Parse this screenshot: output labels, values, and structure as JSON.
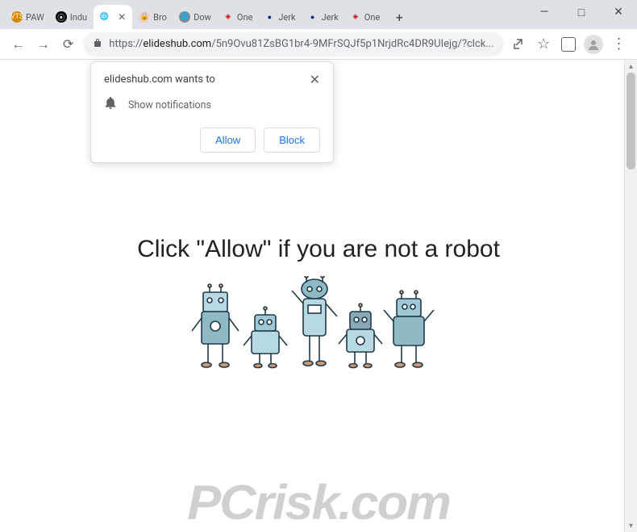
{
  "window": {
    "controls": {
      "min": "—",
      "max": "□",
      "close": "✕"
    }
  },
  "tabs": [
    {
      "label": "PAW",
      "favicon_bg": "#d98600",
      "favicon_txt": "VTS",
      "favicon_color": "#fff"
    },
    {
      "label": "Indu",
      "favicon_bg": "#000",
      "favicon_txt": "⦿",
      "favicon_color": "#fff"
    },
    {
      "label": "",
      "favicon_bg": "#fff",
      "favicon_txt": "🌐",
      "favicon_color": "#1a73e8",
      "active": true
    },
    {
      "label": "Bro",
      "favicon_bg": "#f5cccc",
      "favicon_txt": "🔒",
      "favicon_color": "#d08"
    },
    {
      "label": "Dow",
      "favicon_bg": "#888",
      "favicon_txt": "🌐",
      "favicon_color": "#fff"
    },
    {
      "label": "One",
      "favicon_bg": "#fff",
      "favicon_txt": "◈",
      "favicon_color": "#c00"
    },
    {
      "label": "Jerk",
      "favicon_bg": "#fff",
      "favicon_txt": "●",
      "favicon_color": "#0a2a66"
    },
    {
      "label": "Jerk",
      "favicon_bg": "#fff",
      "favicon_txt": "●",
      "favicon_color": "#0a2a66"
    },
    {
      "label": "One",
      "favicon_bg": "#fff",
      "favicon_txt": "◈",
      "favicon_color": "#c00"
    }
  ],
  "new_tab": "+",
  "nav": {
    "back": "←",
    "forward": "→",
    "reload": "⟳"
  },
  "url": {
    "protocol": "https://",
    "domain": "elideshub.com",
    "path": "/5n9Ovu81ZsBG1br4-9MFrSQJf5p1NrjdRc4DR9UIejg/?clck..."
  },
  "toolbar": {
    "share_icon": "↗",
    "star_icon": "☆",
    "menu_icon": "⋮"
  },
  "permission_popup": {
    "title": "elideshub.com wants to",
    "line": "Show notifications",
    "allow": "Allow",
    "block": "Block"
  },
  "page": {
    "message": "Click \"Allow\"   if you are not   a robot"
  },
  "watermark": {
    "text": "PCrisk.com"
  }
}
